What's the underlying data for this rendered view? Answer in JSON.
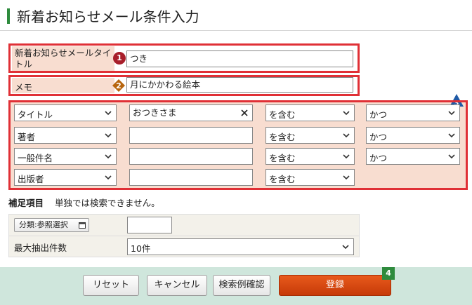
{
  "header": {
    "title": "新着お知らせメール条件入力"
  },
  "form": {
    "title_row": {
      "label": "新着お知らせメールタイトル",
      "badge": "1",
      "value": "つき"
    },
    "memo_row": {
      "label": "メモ",
      "badge": "2",
      "value": "月にかかわる絵本"
    },
    "conditions_badge": "3",
    "conditions": [
      {
        "field": "タイトル",
        "value": "おつきさま",
        "match": "を含む",
        "logic": "かつ"
      },
      {
        "field": "著者",
        "value": "",
        "match": "を含む",
        "logic": "かつ"
      },
      {
        "field": "一般件名",
        "value": "",
        "match": "を含む",
        "logic": "かつ"
      },
      {
        "field": "出版者",
        "value": "",
        "match": "を含む"
      }
    ]
  },
  "supplement": {
    "heading": "補足項目",
    "note": "単独では検索できません。",
    "category_button": "分類:参照選択",
    "category_value": "",
    "max_label": "最大抽出件数",
    "max_value": "10件"
  },
  "footer": {
    "reset": "リセット",
    "cancel": "キャンセル",
    "examples": "検索例確認",
    "register": "登録",
    "register_badge": "4"
  },
  "colors": {
    "accent_green": "#2e8b3d",
    "highlight_red": "#e03036",
    "label_bg": "#f8ddd0",
    "primary_orange": "#d94810",
    "footer_bg": "#cfe6dc"
  }
}
